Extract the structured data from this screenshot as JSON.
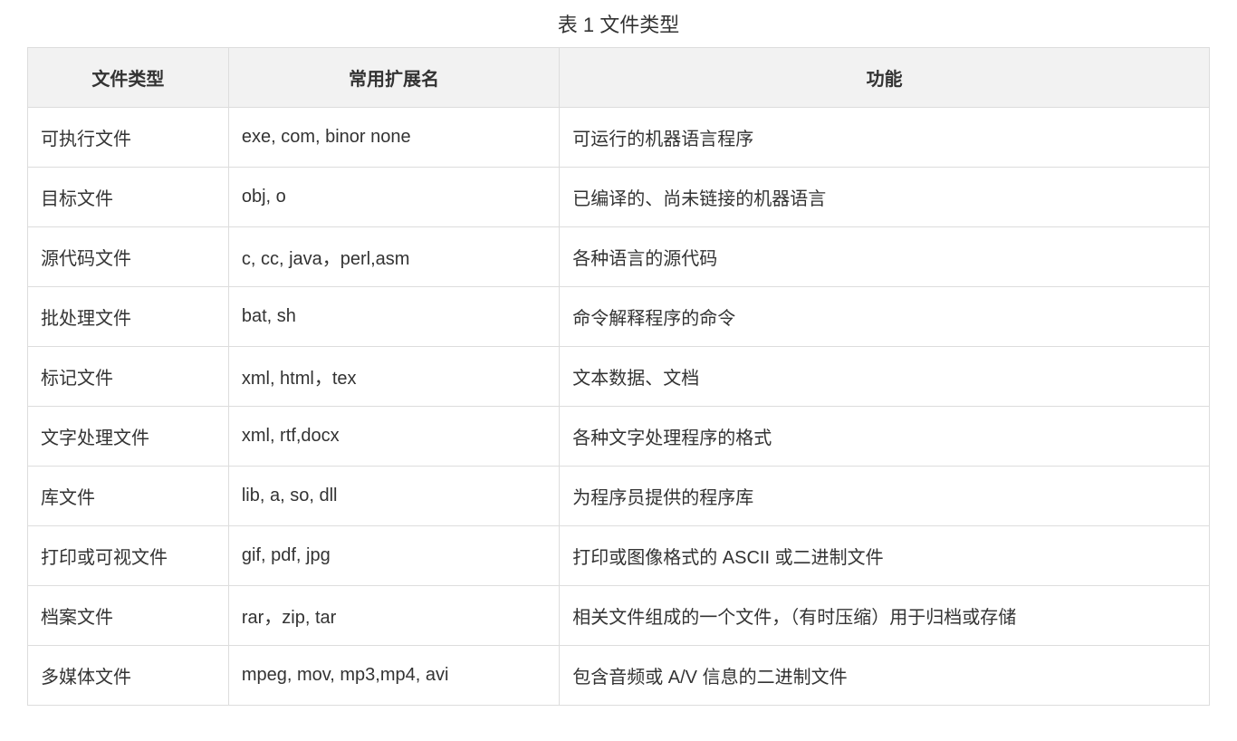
{
  "caption": "表 1 文件类型",
  "headers": [
    "文件类型",
    "常用扩展名",
    "功能"
  ],
  "rows": [
    {
      "type": "可执行文件",
      "ext": "exe, com, binor none",
      "func": "可运行的机器语言程序"
    },
    {
      "type": "目标文件",
      "ext": "obj, o",
      "func": "已编译的、尚未链接的机器语言"
    },
    {
      "type": "源代码文件",
      "ext": "c, cc, java，perl,asm",
      "func": "各种语言的源代码"
    },
    {
      "type": "批处理文件",
      "ext": "bat, sh",
      "func": "命令解释程序的命令"
    },
    {
      "type": "标记文件",
      "ext": "xml, html，tex",
      "func": "文本数据、文档"
    },
    {
      "type": "文字处理文件",
      "ext": "xml, rtf,docx",
      "func": "各种文字处理程序的格式"
    },
    {
      "type": "库文件",
      "ext": "lib, a, so, dll",
      "func": "为程序员提供的程序库"
    },
    {
      "type": "打印或可视文件",
      "ext": "gif, pdf, jpg",
      "func": "打印或图像格式的 ASCII 或二进制文件"
    },
    {
      "type": "档案文件",
      "ext": "rar，zip, tar",
      "func": "相关文件组成的一个文件，（有时压缩）用于归档或存储"
    },
    {
      "type": "多媒体文件",
      "ext": "mpeg, mov, mp3,mp4, avi",
      "func": "包含音频或 A/V 信息的二进制文件"
    }
  ]
}
